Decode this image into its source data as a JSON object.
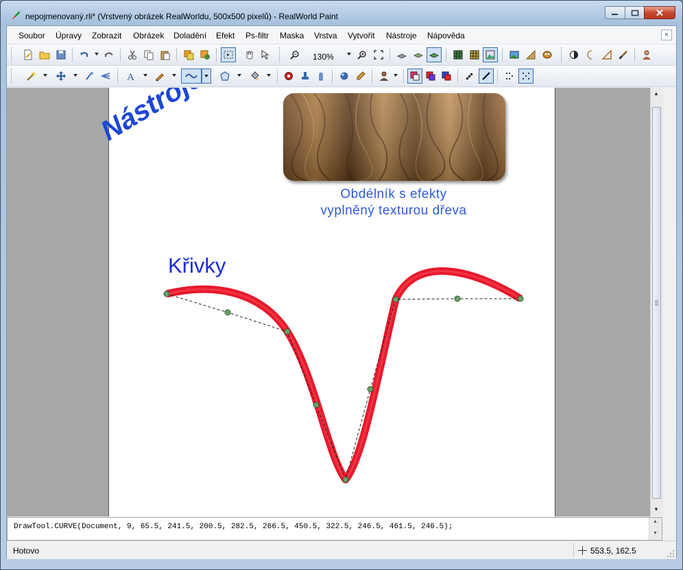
{
  "window": {
    "title": "nepojmenovaný.rli* (Vrstvený obrázek RealWorldu, 500x500 pixelů) - RealWorld Paint",
    "min_label": "minimize",
    "max_label": "maximize",
    "close_label": "close"
  },
  "menu": {
    "items": [
      "Soubor",
      "Úpravy",
      "Zobrazit",
      "Obrázek",
      "Doladění",
      "Efekt",
      "Ps-filtr",
      "Maska",
      "Vrstva",
      "Vytvořit",
      "Nástroje",
      "Nápověda"
    ],
    "doc_close": "×"
  },
  "toolbar": {
    "zoom_value": "130%",
    "icons_row1": [
      "new-document-icon",
      "open-folder-icon",
      "save-icon",
      "undo-icon",
      "redo-icon",
      "cut-icon",
      "copy-icon",
      "paste-icon",
      "layers-icon",
      "layer-effects-icon",
      "selection-tool-icon",
      "hand-icon",
      "pointer-icon",
      "zoom-out-icon",
      "zoom-in-icon",
      "fit-screen-icon",
      "layer-down-icon",
      "layer-up-icon",
      "layer-active-icon",
      "grid-icon",
      "pixel-grid-icon",
      "image-icon",
      "landscape-icon",
      "triangle-icon",
      "mask-icon",
      "contrast-icon",
      "moon-icon",
      "ruler-icon",
      "brush-icon",
      "user-icon"
    ],
    "icons_row2": [
      "magic-wand-icon",
      "move-icon",
      "retouch-icon",
      "clone-icon",
      "text-icon",
      "pencil-icon",
      "curve-icon",
      "polygon-icon",
      "fill-icon",
      "eye-icon",
      "stamp-icon",
      "finger-icon",
      "sphere-icon",
      "eyedropper-icon",
      "person-icon",
      "color-swap-icon",
      "color-mix-icon",
      "color-overlay-icon",
      "pattern-icon",
      "line-icon",
      "dots-icon",
      "selection-dots-icon"
    ]
  },
  "canvas": {
    "title_text": "Nástroje",
    "wood_caption_line1": "Obdélník s efekty",
    "wood_caption_line2": "vyplněný texturou dřeva",
    "curves_heading": "Křivky",
    "curve_color": "#e8192c",
    "text_blue": "#1d47d6"
  },
  "script": {
    "command": "DrawTool.CURVE(Document, 9, 65.5, 241.5, 200.5, 282.5, 266.5, 450.5, 322.5, 246.5, 461.5, 246.5);"
  },
  "status": {
    "text": "Hotovo",
    "coords": "553.5, 162.5"
  }
}
